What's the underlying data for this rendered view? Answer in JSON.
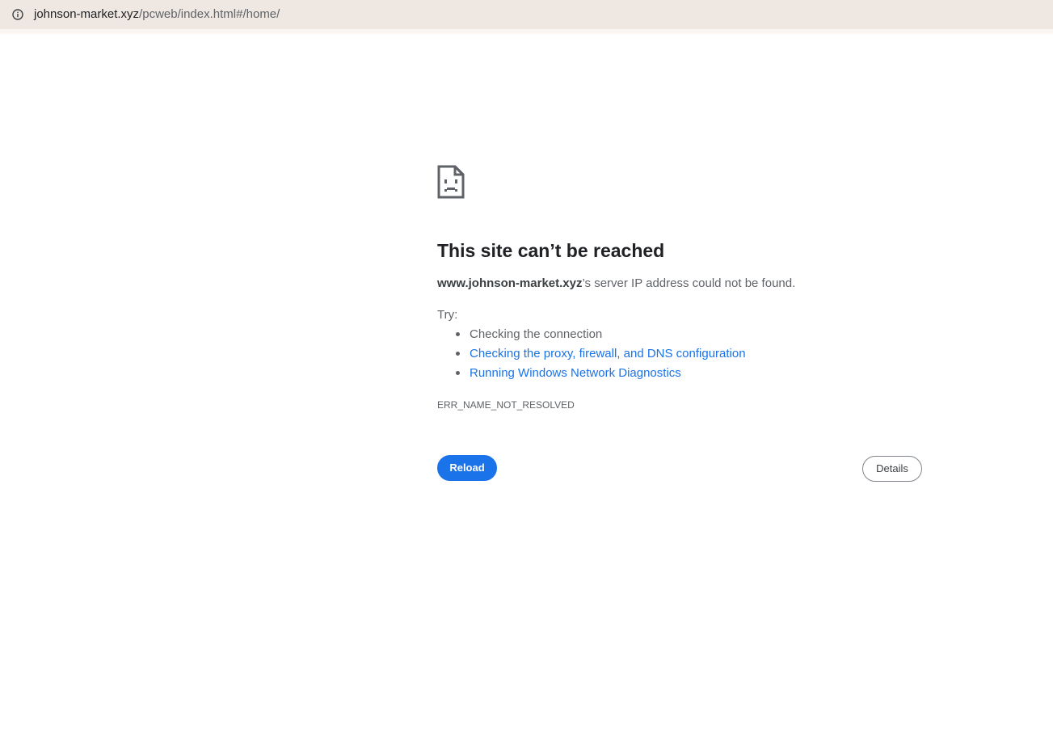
{
  "address_bar": {
    "info_icon": "info-circle-icon",
    "url_host": "johnson-market.xyz",
    "url_path": "/pcweb/index.html#/home/"
  },
  "error_page": {
    "icon": "sad-document-icon",
    "title": "This site can’t be reached",
    "domain": "www.johnson-market.xyz",
    "summary_suffix": "’s server IP address could not be found.",
    "try_label": "Try:",
    "suggestions": [
      {
        "text": "Checking the connection",
        "is_link": false
      },
      {
        "text": "Checking the proxy, firewall, and DNS configuration",
        "is_link": true
      },
      {
        "text": "Running Windows Network Diagnostics",
        "is_link": true
      }
    ],
    "error_code": "ERR_NAME_NOT_RESOLVED",
    "reload_label": "Reload",
    "details_label": "Details"
  },
  "colors": {
    "accent": "#1a73e8",
    "address_bar_bg": "#efe8e2",
    "text_primary": "#202124",
    "text_secondary": "#5f6368"
  }
}
